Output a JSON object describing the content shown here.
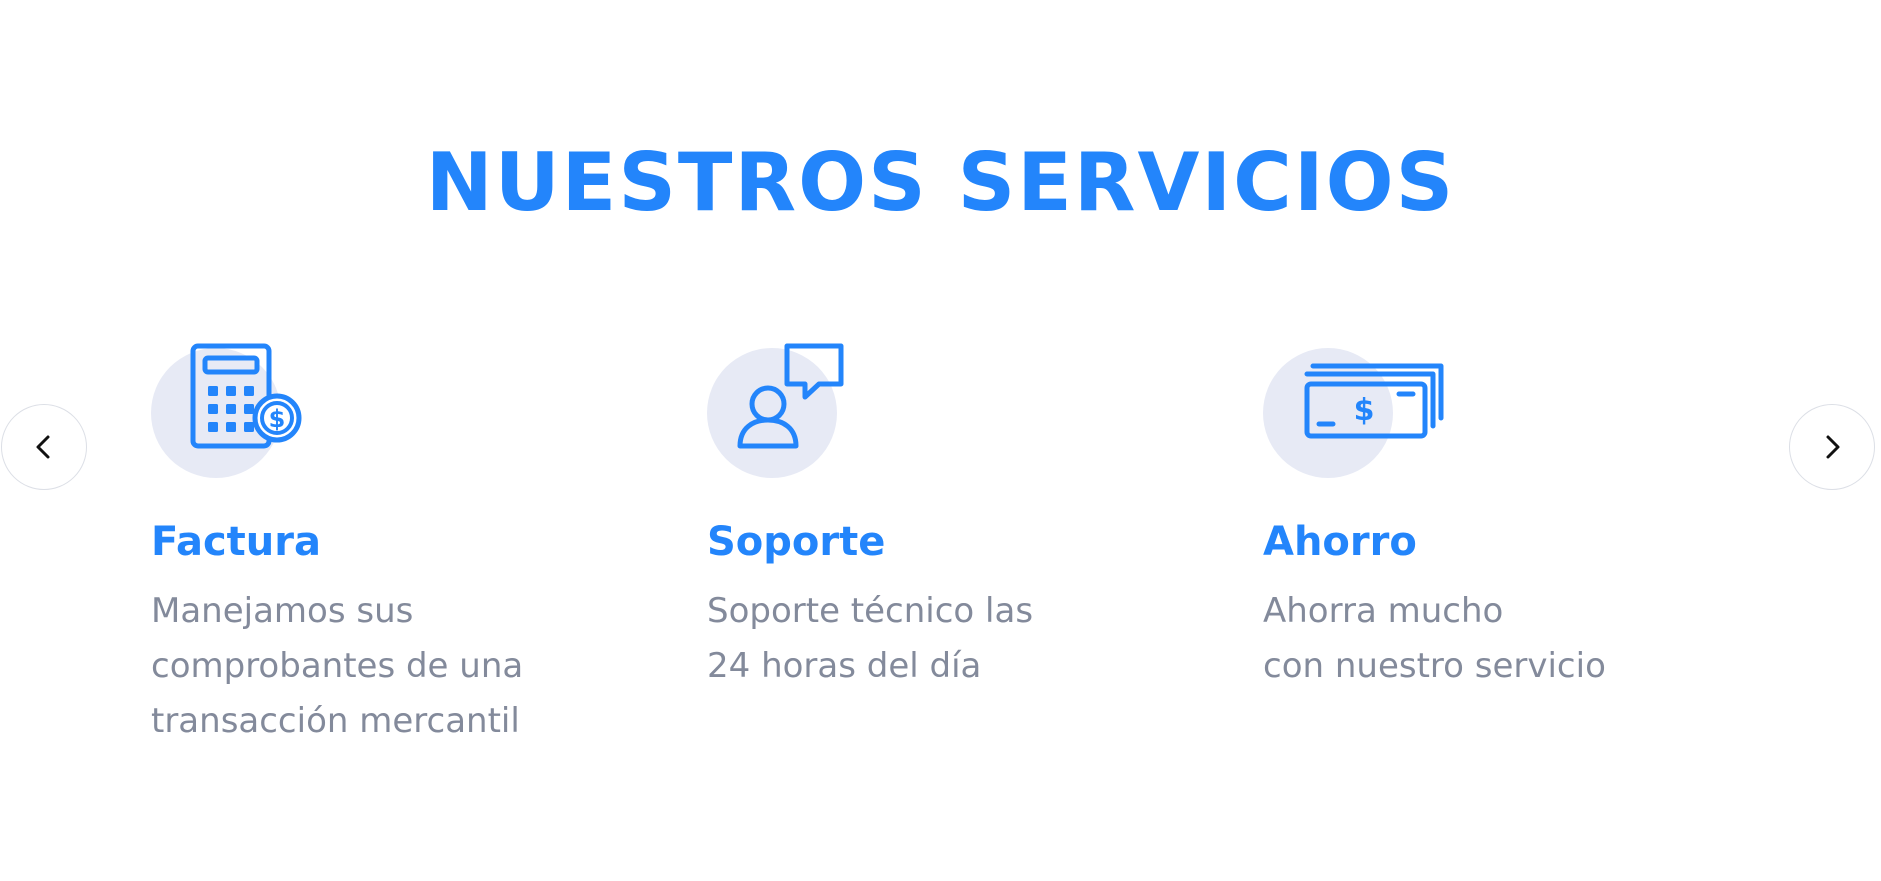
{
  "section": {
    "title": "NUESTROS SERVICIOS"
  },
  "colors": {
    "accent": "#2385fb",
    "text_muted": "#838a9b",
    "icon_bg": "#e7eaf5"
  },
  "carousel": {
    "prev_icon": "chevron-left-icon",
    "next_icon": "chevron-right-icon"
  },
  "services": [
    {
      "icon": "calculator-dollar-icon",
      "title": "Factura",
      "description_lines": [
        "Manejamos sus",
        "comprobantes de una",
        "transacción mercantil"
      ]
    },
    {
      "icon": "user-chat-icon",
      "title": "Soporte",
      "description_lines": [
        "Soporte técnico las",
        "24 horas del día"
      ]
    },
    {
      "icon": "money-bills-icon",
      "title": "Ahorro",
      "description_lines": [
        "Ahorra mucho",
        "con nuestro servicio"
      ]
    }
  ]
}
